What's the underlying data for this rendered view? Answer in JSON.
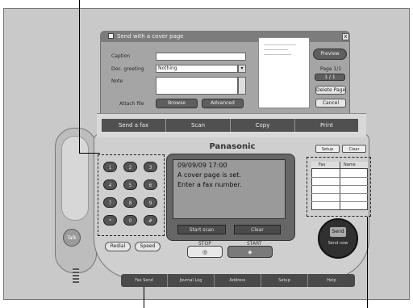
{
  "dialog": {
    "title": "Send with a cover page",
    "fields": [
      {
        "label": "Caption",
        "value": ""
      },
      {
        "label": "Doc. greeting",
        "value": "Nothing"
      },
      {
        "label": "Note",
        "value": ""
      }
    ],
    "attach_label": "Attach file",
    "browse_label": "Browse",
    "advanced_label": "Advanced",
    "preview_label": "Preview",
    "page_label": "Page 1/1",
    "page_value": "1 / 1",
    "delete_label": "Delete Page",
    "cancel_label": "Cancel",
    "close_label": "x"
  },
  "tabs": [
    "Send a fax",
    "Scan",
    "Copy",
    "Print"
  ],
  "brand": "Panasonic",
  "top_buttons": [
    "Setup",
    "Clear"
  ],
  "keypad": [
    "1",
    "2",
    "3",
    "4",
    "5",
    "6",
    "7",
    "8",
    "9",
    "*",
    "0",
    "#"
  ],
  "side_buttons": [
    "Redial",
    "Speed"
  ],
  "lcd": {
    "lines": [
      "09/09/09 17:00",
      "A cover page is set.",
      "Enter a fax number."
    ]
  },
  "softkeys": [
    "Start scan",
    "Clear"
  ],
  "stop_label": "STOP",
  "start_label": "START",
  "stop_symbol": "◎",
  "start_symbol": "◈",
  "list": {
    "headers": [
      "Fax",
      "Name"
    ],
    "rows": [
      "",
      "",
      "",
      "",
      ""
    ]
  },
  "round_button": {
    "title": "Send",
    "subtitle": "Send now"
  },
  "handset_label": "Talk",
  "bottom_tabs": [
    "Fax Send",
    "Journal Log",
    "Address",
    "Setup",
    "Help"
  ],
  "colors": {
    "frame": "#c9c9c9",
    "device": "#cfcfcf",
    "dark": "#505050",
    "lcd": "#9a9a9a"
  }
}
